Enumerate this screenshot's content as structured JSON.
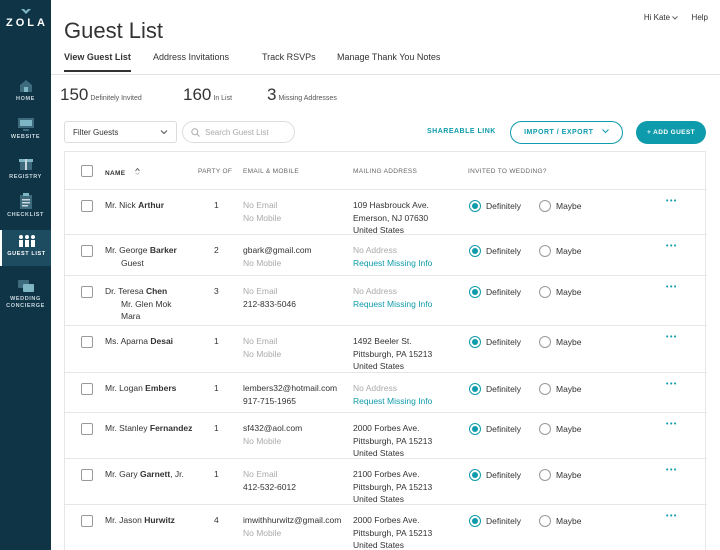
{
  "sidebar": {
    "logo": "ZOLA",
    "items": [
      {
        "label": "HOME",
        "icon": "home-icon"
      },
      {
        "label": "WEBSITE",
        "icon": "website-icon"
      },
      {
        "label": "REGISTRY",
        "icon": "registry-icon"
      },
      {
        "label": "CHECKLIST",
        "icon": "checklist-icon"
      },
      {
        "label": "GUEST LIST",
        "icon": "guest-list-icon",
        "active": true
      },
      {
        "label": "WEDDING",
        "label2": "CONCIERGE",
        "icon": "concierge-icon"
      }
    ]
  },
  "header": {
    "title": "Guest List",
    "greeting": "Hi Kate",
    "help": "Help"
  },
  "tabs": [
    "View Guest List",
    "Address Invitations",
    "Track RSVPs",
    "Manage Thank You Notes"
  ],
  "stats": [
    {
      "num": "150",
      "label": "Definitely Invited"
    },
    {
      "num": "160",
      "label": "In List"
    },
    {
      "num": "3",
      "label": "Missing Addresses"
    }
  ],
  "toolbar": {
    "filter": "Filter Guests",
    "search_placeholder": "Search Guest List",
    "share": "SHAREABLE LINK",
    "import": "IMPORT / EXPORT",
    "add": "+ ADD GUEST"
  },
  "table": {
    "headers": {
      "name": "NAME",
      "party": "PARTY OF",
      "email": "EMAIL & MOBILE",
      "address": "MAILING ADDRESS",
      "invited": "INVITED TO WEDDING?"
    },
    "opt_yes": "Definitely",
    "opt_maybe": "Maybe",
    "rows": [
      {
        "title": "Mr. Nick",
        "last": "Arthur",
        "suffix": "",
        "others": [],
        "party": "1",
        "email": "No Email",
        "email_muted": true,
        "mobile": "No Mobile",
        "mobile_muted": true,
        "addr": [
          "109 Hasbrouck Ave.",
          "Emerson, NJ 07630",
          "United States"
        ],
        "addr_missing": false
      },
      {
        "title": "Mr. George",
        "last": "Barker",
        "suffix": "",
        "others": [
          "Guest"
        ],
        "party": "2",
        "email": "gbark@gmail.com",
        "email_muted": false,
        "mobile": "No Mobile",
        "mobile_muted": true,
        "addr": [
          "No Address",
          "Request Missing Info"
        ],
        "addr_missing": true
      },
      {
        "title": "Dr. Teresa",
        "last": "Chen",
        "suffix": "",
        "others": [
          "Mr. Glen Mok",
          "Mara"
        ],
        "party": "3",
        "email": "No Email",
        "email_muted": true,
        "mobile": "212-833-5046",
        "mobile_muted": false,
        "addr": [
          "No Address",
          "Request Missing Info"
        ],
        "addr_missing": true
      },
      {
        "title": "Ms. Aparna",
        "last": "Desai",
        "suffix": "",
        "others": [],
        "party": "1",
        "email": "No Email",
        "email_muted": true,
        "mobile": "No Mobile",
        "mobile_muted": true,
        "addr": [
          "1492 Beeler St.",
          "Pittsburgh, PA 15213",
          "United States"
        ],
        "addr_missing": false
      },
      {
        "title": "Mr. Logan",
        "last": "Embers",
        "suffix": "",
        "others": [],
        "party": "1",
        "email": "lembers32@hotmail.com",
        "email_muted": false,
        "mobile": "917-715-1965",
        "mobile_muted": false,
        "addr": [
          "No Address",
          "Request Missing Info"
        ],
        "addr_missing": true
      },
      {
        "title": "Mr. Stanley",
        "last": "Fernandez",
        "suffix": "",
        "others": [],
        "party": "1",
        "email": "sf432@aol.com",
        "email_muted": false,
        "mobile": "No Mobile",
        "mobile_muted": true,
        "addr": [
          "2000 Forbes Ave.",
          "Pittsburgh, PA 15213",
          "United States"
        ],
        "addr_missing": false
      },
      {
        "title": "Mr. Gary",
        "last": "Garnett",
        "suffix": ", Jr.",
        "others": [],
        "party": "1",
        "email": "No Email",
        "email_muted": true,
        "mobile": "412-532-6012",
        "mobile_muted": false,
        "addr": [
          "2100 Forbes Ave.",
          "Pittsburgh, PA 15213",
          "United States"
        ],
        "addr_missing": false
      },
      {
        "title": "Mr. Jason",
        "last": "Hurwitz",
        "suffix": "",
        "others": [],
        "party": "4",
        "email": "imwithhurwitz@gmail.com",
        "email_muted": false,
        "mobile": "No Mobile",
        "mobile_muted": true,
        "addr": [
          "2000 Forbes Ave.",
          "Pittsburgh, PA 15213",
          "United States"
        ],
        "addr_missing": false
      }
    ]
  },
  "colors": {
    "accent": "#0e9bab",
    "sidebar": "#0e3446"
  }
}
